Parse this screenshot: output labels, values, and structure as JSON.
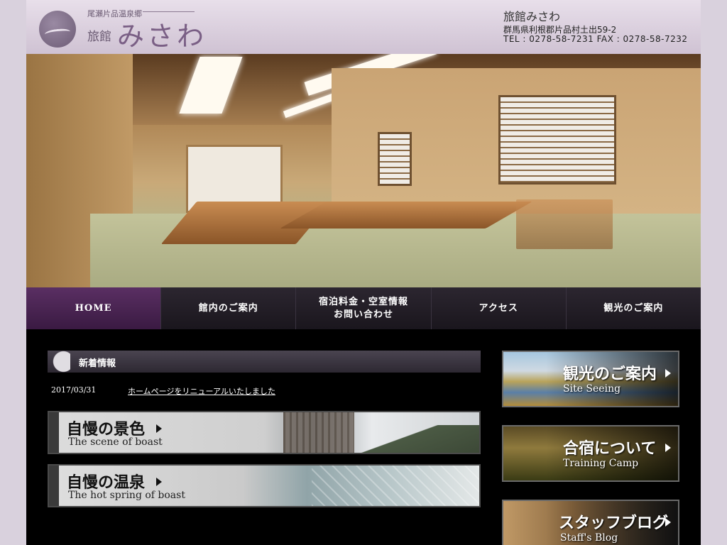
{
  "header": {
    "logo_sub": "尾瀬片品温泉郷",
    "logo_ryokan": "旅館",
    "logo_name": "みさわ",
    "name": "旅館みさわ",
    "address": "群馬県利根郡片品村土出59-2",
    "tel": "TEL : 0278-58-7231   FAX : 0278-58-7232"
  },
  "nav": {
    "items": [
      {
        "label": "HOME"
      },
      {
        "label": "館内のご案内"
      },
      {
        "label": "宿泊料金・空室情報\nお問い合わせ"
      },
      {
        "label": "アクセス"
      },
      {
        "label": "観光のご案内"
      }
    ]
  },
  "news": {
    "title": "新着情報",
    "entries": [
      {
        "date": "2017/03/31",
        "text": "ホームページをリニューアルいたしました"
      }
    ]
  },
  "boast": {
    "scene": {
      "jp": "自慢の景色",
      "en": "The scene of boast"
    },
    "spring": {
      "jp": "自慢の温泉",
      "en": "The hot spring of boast"
    }
  },
  "side": {
    "sight": {
      "jp": "観光のご案内",
      "en": "Site Seeing"
    },
    "camp": {
      "jp": "合宿について",
      "en": "Training Camp"
    },
    "blog": {
      "jp": "スタッフブログ",
      "en": "Staff's Blog"
    }
  }
}
